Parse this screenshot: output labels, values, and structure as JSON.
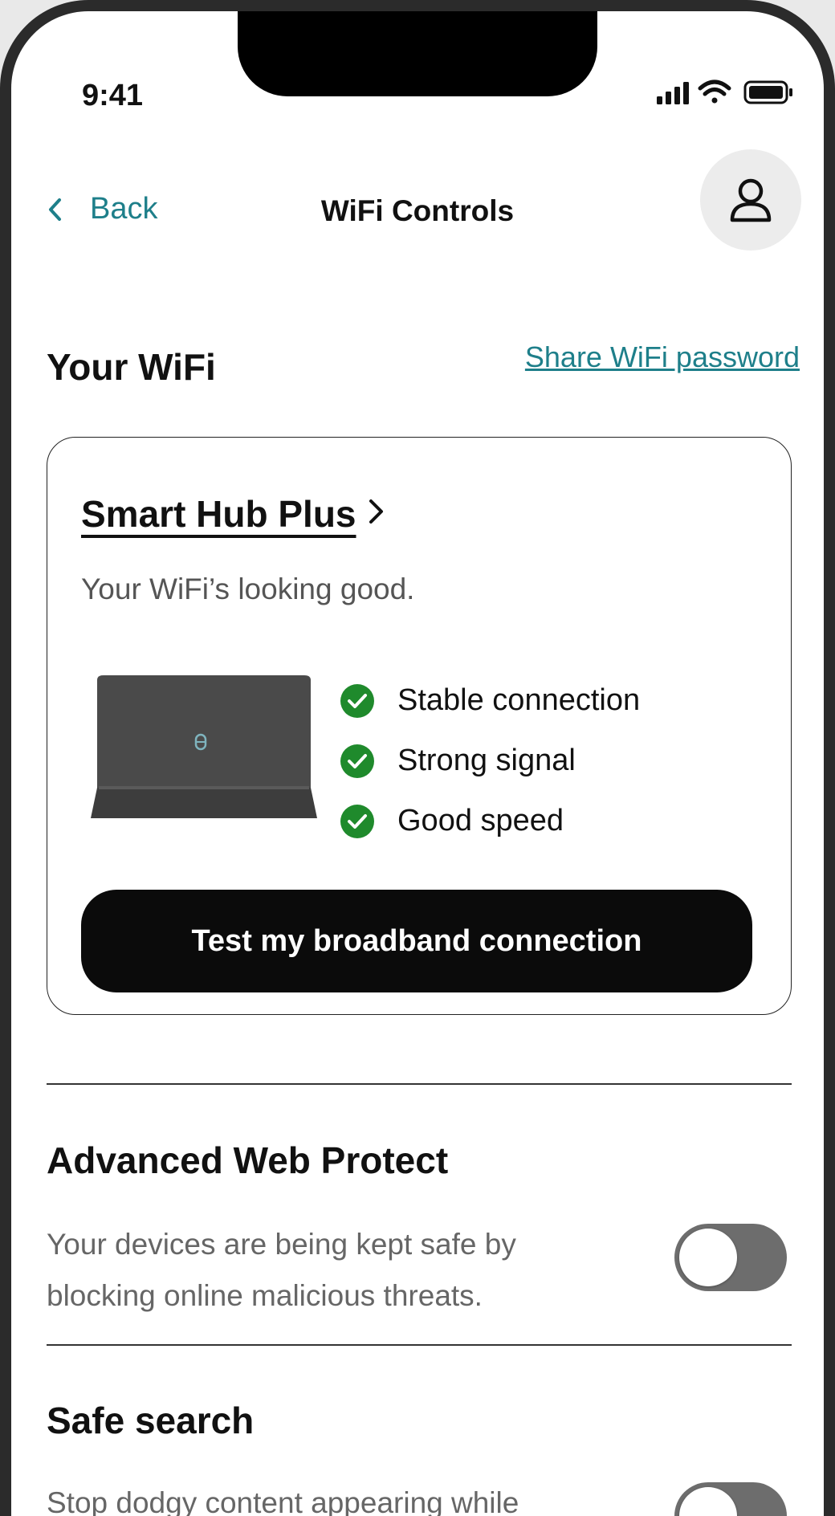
{
  "status_bar": {
    "time": "9:41"
  },
  "nav": {
    "back_label": "Back",
    "title": "WiFi Controls"
  },
  "wifi_section": {
    "title": "Your WiFi",
    "share_link": "Share WiFi password"
  },
  "hub_card": {
    "name": "Smart Hub Plus",
    "status": "Your WiFi’s looking good.",
    "checks": [
      "Stable connection",
      "Strong signal",
      "Good speed"
    ],
    "test_button": "Test my broadband connection"
  },
  "advanced_web_protect": {
    "title": "Advanced Web Protect",
    "description": "Your devices are being kept safe by blocking online malicious threats.",
    "toggle_on": false
  },
  "safe_search": {
    "title": "Safe search",
    "description": "Stop dodgy content appearing while",
    "toggle_on": false
  },
  "colors": {
    "accent": "#1e7f8a",
    "check_green": "#1f8a2c",
    "button_bg": "#0b0b0b",
    "toggle_track": "#6d6d6d"
  },
  "icons": {
    "back": "chevron-left-icon",
    "profile": "user-icon",
    "hub_arrow": "chevron-right-icon",
    "check": "check-circle-icon"
  }
}
